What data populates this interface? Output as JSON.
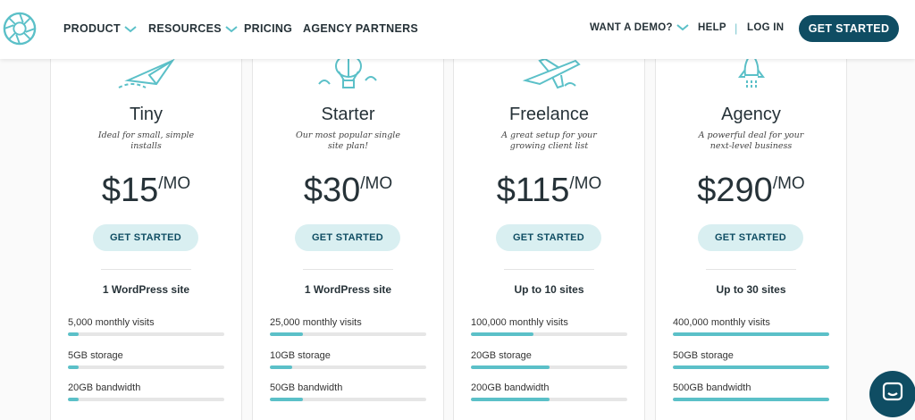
{
  "nav": {
    "left_items": [
      {
        "label": "PRODUCT",
        "has_dropdown": true
      },
      {
        "label": "RESOURCES",
        "has_dropdown": true
      },
      {
        "label": "PRICING",
        "has_dropdown": false
      },
      {
        "label": "AGENCY PARTNERS",
        "has_dropdown": false
      }
    ],
    "demo_label": "WANT A DEMO?",
    "help_label": "HELP",
    "separator": "|",
    "login_label": "LOG IN",
    "cta_label": "GET STARTED"
  },
  "plans": [
    {
      "name": "Tiny",
      "icon": "paper-plane-icon",
      "description": "Ideal for small, simple installs",
      "price": "$15",
      "per": "/MO",
      "cta": "GET STARTED",
      "sites": "1 WordPress site",
      "features": [
        {
          "label": "5,000 monthly visits",
          "level": 0.07
        },
        {
          "label": "5GB storage",
          "level": 0.07
        },
        {
          "label": "20GB bandwidth",
          "level": 0.07
        }
      ]
    },
    {
      "name": "Starter",
      "icon": "hot-air-balloon-icon",
      "description": "Our most popular single site plan!",
      "price": "$30",
      "per": "/MO",
      "cta": "GET STARTED",
      "sites": "1 WordPress site",
      "features": [
        {
          "label": "25,000 monthly visits",
          "level": 0.21
        },
        {
          "label": "10GB storage",
          "level": 0.14
        },
        {
          "label": "50GB bandwidth",
          "level": 0.21
        }
      ]
    },
    {
      "name": "Freelance",
      "icon": "airplane-icon",
      "description": "A great setup for your growing client list",
      "price": "$115",
      "per": "/MO",
      "cta": "GET STARTED",
      "sites": "Up to 10 sites",
      "features": [
        {
          "label": "100,000 monthly visits",
          "level": 0.4
        },
        {
          "label": "20GB storage",
          "level": 0.5
        },
        {
          "label": "200GB bandwidth",
          "level": 0.5
        }
      ]
    },
    {
      "name": "Agency",
      "icon": "rocket-icon",
      "description": "A powerful deal for your next-level business",
      "price": "$290",
      "per": "/MO",
      "cta": "GET STARTED",
      "sites": "Up to 30 sites",
      "features": [
        {
          "label": "400,000 monthly visits",
          "level": 1.0
        },
        {
          "label": "50GB storage",
          "level": 1.0
        },
        {
          "label": "500GB bandwidth",
          "level": 1.0
        }
      ]
    }
  ],
  "chat": {
    "icon": "chat-icon"
  },
  "colors": {
    "brand_dark": "#0f4d63",
    "accent": "#5bc0c8",
    "cta_light": "#d9eff1",
    "bar_track": "#e6e6e6"
  }
}
